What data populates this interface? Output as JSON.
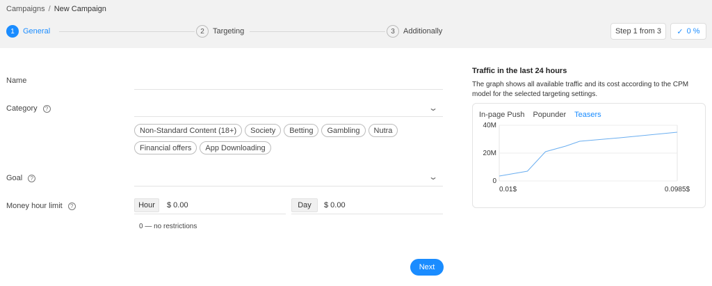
{
  "breadcrumb": {
    "parent": "Campaigns",
    "separator": "/",
    "current": "New Campaign"
  },
  "steps": [
    {
      "num": "1",
      "label": "General",
      "active": true
    },
    {
      "num": "2",
      "label": "Targeting",
      "active": false
    },
    {
      "num": "3",
      "label": "Additionally",
      "active": false
    }
  ],
  "step_counter": "Step 1 from 3",
  "progress": {
    "label": "0 %",
    "value": 0
  },
  "form": {
    "name_label": "Name",
    "name_value": "",
    "category_label": "Category",
    "category_value": "",
    "category_chips": [
      "Non-Standard Content (18+)",
      "Society",
      "Betting",
      "Gambling",
      "Nutra",
      "Financial offers",
      "App Downloading"
    ],
    "goal_label": "Goal",
    "goal_value": "",
    "money_label": "Money hour limit",
    "hour_unit": "Hour",
    "hour_value": "$ 0.00",
    "day_unit": "Day",
    "day_value": "$ 0.00",
    "hint": "0 — no restrictions",
    "next_label": "Next"
  },
  "traffic": {
    "title": "Traffic in the last 24 hours",
    "description": "The graph shows all available traffic and its cost according to the CPM model for the selected targeting settings.",
    "tabs": [
      "In-page Push",
      "Popunder",
      "Teasers"
    ],
    "active_tab": 2
  },
  "colors": {
    "accent": "#1a8cff",
    "line": "#6aaef0"
  },
  "chart_data": {
    "type": "line",
    "x_ticks": [
      "0.01$",
      "0.0985$"
    ],
    "y_ticks": [
      "0",
      "20M",
      "40M"
    ],
    "ylim": [
      0,
      40000000
    ],
    "xlim": [
      0.01,
      0.0985
    ],
    "grid": true,
    "series": [
      {
        "values": [
          [
            0.01,
            3500000
          ],
          [
            0.024,
            7000000
          ],
          [
            0.033,
            21000000
          ],
          [
            0.043,
            25000000
          ],
          [
            0.05,
            28500000
          ],
          [
            0.07,
            31000000
          ],
          [
            0.0985,
            35000000
          ]
        ]
      }
    ]
  }
}
